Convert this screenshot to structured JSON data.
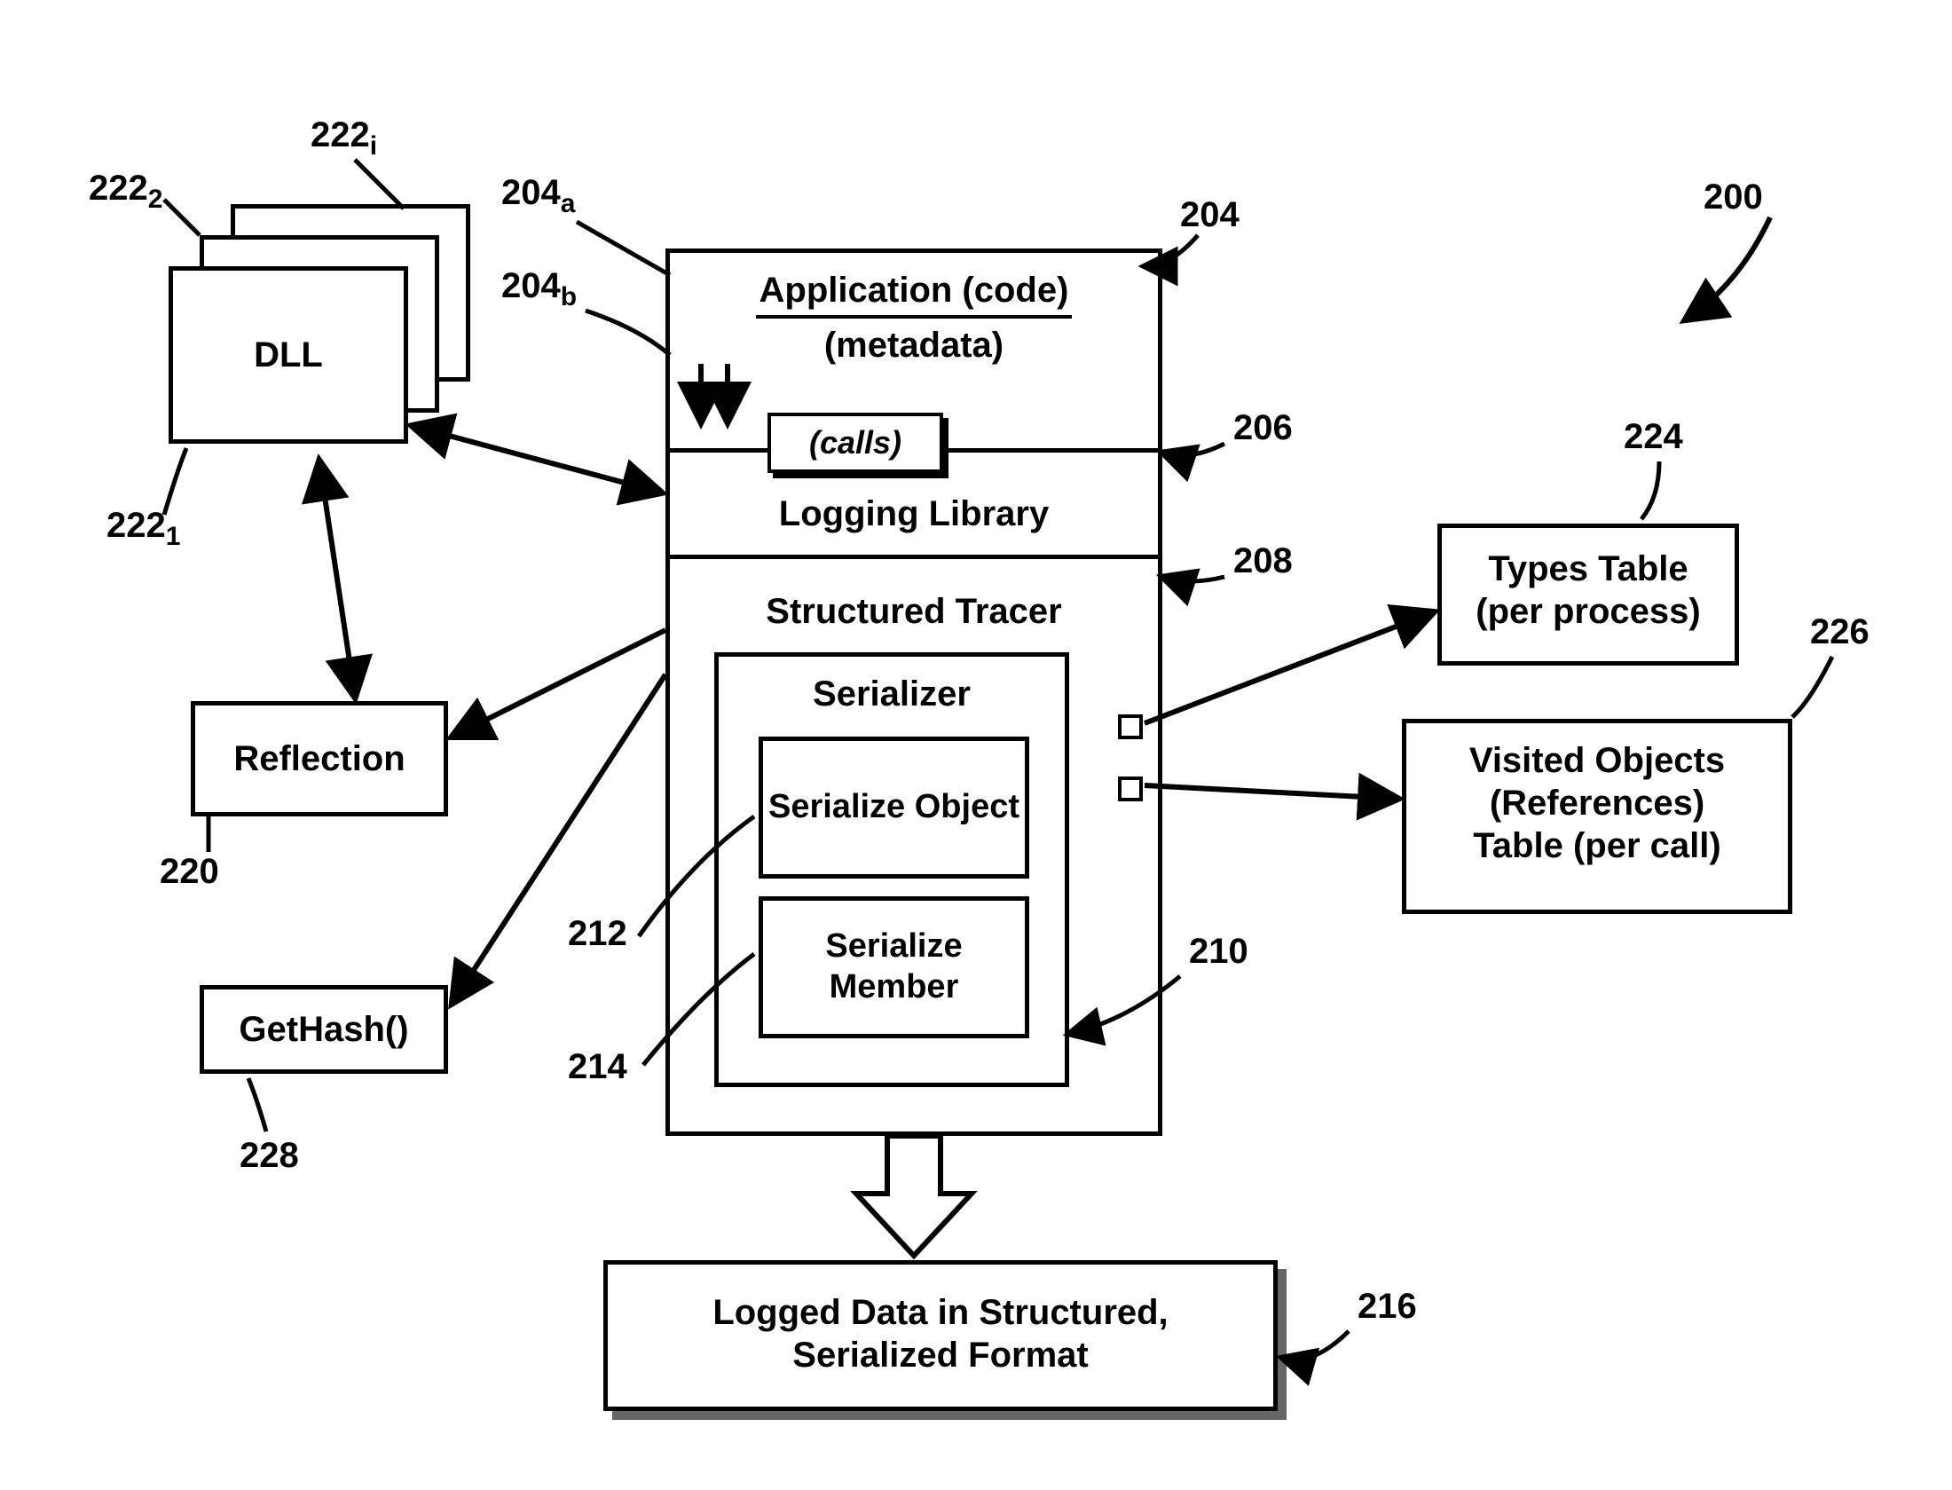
{
  "refs": {
    "r200": "200",
    "r204": "204",
    "r204a": "204",
    "r204a_sub": "a",
    "r204b": "204",
    "r204b_sub": "b",
    "r206": "206",
    "r208": "208",
    "r210": "210",
    "r212": "212",
    "r214": "214",
    "r216": "216",
    "r220": "220",
    "r222_1": "222",
    "r222_1_sub": "1",
    "r222_2": "222",
    "r222_2_sub": "2",
    "r222_i": "222",
    "r222_i_sub": "i",
    "r224": "224",
    "r226": "226",
    "r228": "228"
  },
  "boxes": {
    "dll": "DLL",
    "reflection": "Reflection",
    "gethash": "GetHash()",
    "app_code": "Application (code)",
    "app_meta": "(metadata)",
    "calls": "(calls)",
    "logging_library": "Logging Library",
    "structured_tracer": "Structured Tracer",
    "serializer": "Serializer",
    "serialize_object": "Serialize Object",
    "serialize_member": "Serialize Member",
    "types_table_l1": "Types Table",
    "types_table_l2": "(per process)",
    "visited_l1": "Visited Objects",
    "visited_l2": "(References)",
    "visited_l3": "Table (per call)",
    "logged_l1": "Logged Data in Structured,",
    "logged_l2": "Serialized Format"
  }
}
